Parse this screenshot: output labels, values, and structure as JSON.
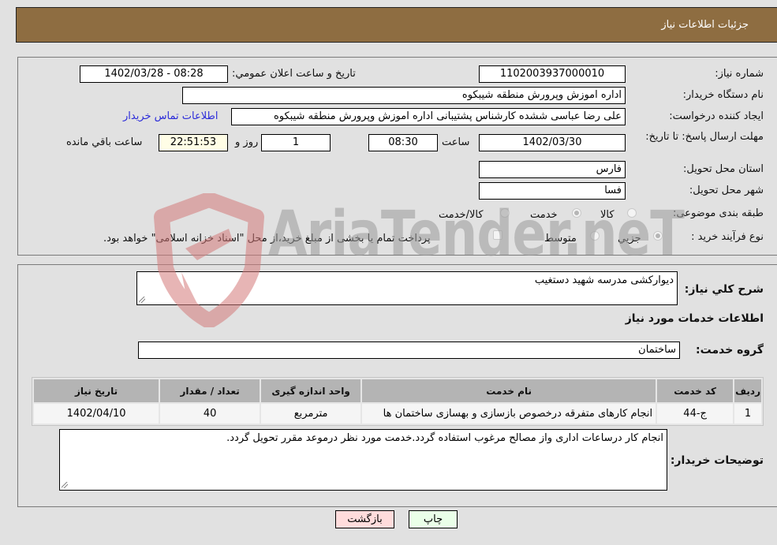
{
  "header": {
    "title": "جزئيات اطلاعات نياز"
  },
  "info": {
    "need_number_label": "شماره نیاز:",
    "need_number": "1102003937000010",
    "announce_label": "تاريخ و ساعت اعلان عمومي:",
    "announce_value": "1402/03/28 - 08:28",
    "buyer_org_label": "نام دستگاه خریدار:",
    "buyer_org": "اداره اموزش وپرورش منطقه شیبکوه",
    "requester_label": "ایجاد کننده درخواست:",
    "requester": "علی رضا عباسی ششده کارشناس پشتیبانی اداره اموزش وپرورش منطقه شیبکوه",
    "buyer_contact_link": "اطلاعات تماس خريدار",
    "deadline_label": "مهلت ارسال پاسخ: تا تاریخ:",
    "deadline_date": "1402/03/30",
    "time_label": "ساعت",
    "deadline_time": "08:30",
    "days_value": "1",
    "days_label": "روز و",
    "remaining_time": "22:51:53",
    "remaining_label": "ساعت باقي مانده",
    "province_label": "استان محل تحویل:",
    "province": "فارس",
    "city_label": "شهر محل تحویل:",
    "city": "فسا",
    "category_label": "طبقه بندی موضوعی:",
    "category_options": [
      {
        "label": "کالا",
        "selected": false
      },
      {
        "label": "خدمت",
        "selected": true
      },
      {
        "label": "کالا/خدمت",
        "selected": false
      }
    ],
    "process_label": "نوع فرآیند خرید :",
    "process_options": [
      {
        "label": "جزيي",
        "selected": true
      },
      {
        "label": "متوسط",
        "selected": false
      }
    ],
    "treasury_check_label": "پرداخت تمام یا بخشی از مبلغ خرید،از محل \"اسناد خزانه اسلامی\" خواهد بود.",
    "treasury_checked": false
  },
  "details": {
    "summary_label": "شرح كلي نياز:",
    "summary": "دیوارکشی مدرسه شهید دستغیب",
    "services_heading": "اطلاعات خدمات مورد نياز",
    "service_group_label": "گروه خدمت:",
    "service_group": "ساختمان",
    "table": {
      "headers": [
        "رديف",
        "کد خدمت",
        "نام خدمت",
        "واحد اندازه گیری",
        "تعداد / مقدار",
        "تاریخ نیاز"
      ],
      "rows": [
        [
          "1",
          "ج-44",
          "انجام کارهای متفرقه درخصوص بازسازی و بهسازی ساختمان ها",
          "مترمربع",
          "40",
          "1402/04/10"
        ]
      ]
    },
    "buyer_notes_label": "توضيحات خريدار:",
    "buyer_notes": "انجام کار درساعات اداری واز مصالح مرغوب استفاده گردد.خدمت مورد نظر درموعد مقرر تحویل گردد."
  },
  "buttons": {
    "print": "چاپ",
    "back": "بازگشت"
  },
  "colors": {
    "header_bg": "#8e6d41",
    "print_bg": "#eaffe8",
    "back_bg": "#ffdcdc",
    "link": "#2b2bd9"
  },
  "watermark": {
    "text": "AriaTender.neT"
  }
}
